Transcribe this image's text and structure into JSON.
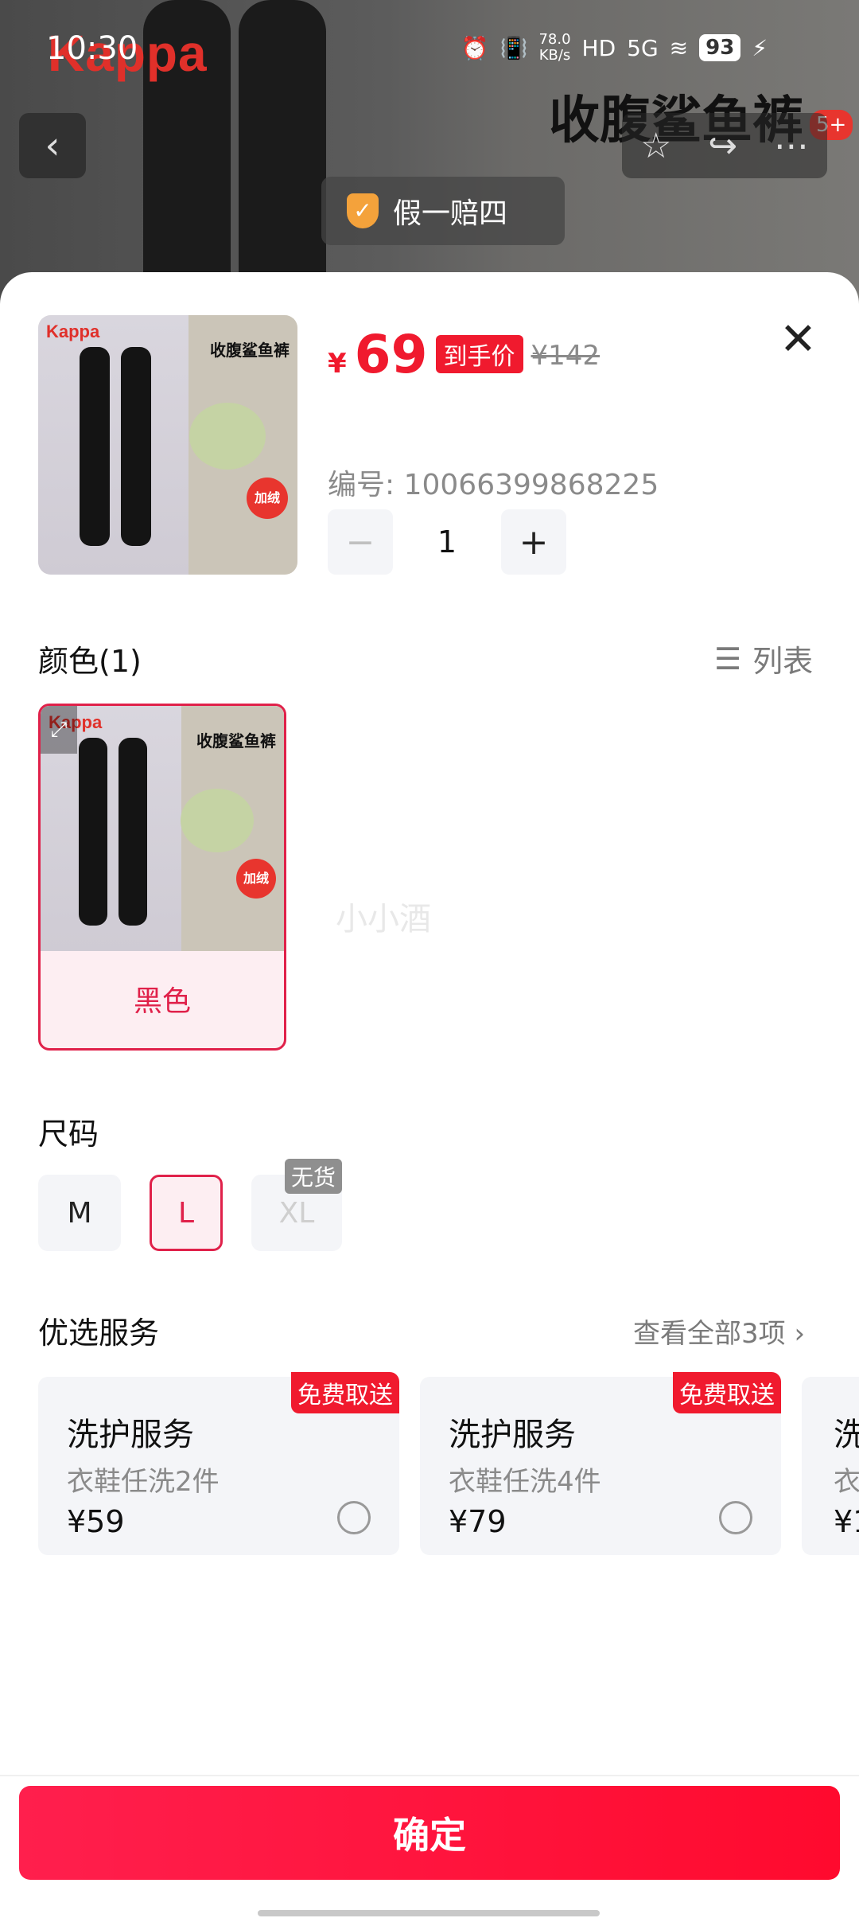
{
  "status_bar": {
    "time": "10:30",
    "net_speed": "78.0",
    "net_unit": "KB/s",
    "signal": "5G",
    "battery": "93"
  },
  "background": {
    "brand": "Kappa",
    "product_title": "收腹鲨鱼裤",
    "image_badge": "5+",
    "guarantee": "假一赔四"
  },
  "sheet": {
    "currency": "¥",
    "price": "69",
    "price_tag": "到手价",
    "original_price": "¥142",
    "sku": "编号: 10066399868225",
    "quantity": "1",
    "thumb_brand": "Kappa",
    "thumb_title": "收腹鲨鱼裤",
    "thumb_tag": "加绒"
  },
  "color_section": {
    "title": "颜色(1)",
    "list_label": "列表",
    "option_label": "黑色",
    "watermark": "小小酒"
  },
  "size_section": {
    "title": "尺码",
    "sizes": [
      "M",
      "L",
      "XL"
    ],
    "selected": "L",
    "soldout_label": "无货"
  },
  "service_section": {
    "title": "优选服务",
    "view_all": "查看全部3项 ›",
    "cards": [
      {
        "badge": "免费取送",
        "name": "洗护服务",
        "sub": "衣鞋任洗2件",
        "price": "¥59"
      },
      {
        "badge": "免费取送",
        "name": "洗护服务",
        "sub": "衣鞋任洗4件",
        "price": "¥79"
      },
      {
        "badge": "",
        "name": "洗",
        "sub": "衣",
        "price": "¥1"
      }
    ]
  },
  "confirm_label": "确定",
  "colors": {
    "accent": "#f01a2e",
    "selected_border": "#e0214a"
  }
}
